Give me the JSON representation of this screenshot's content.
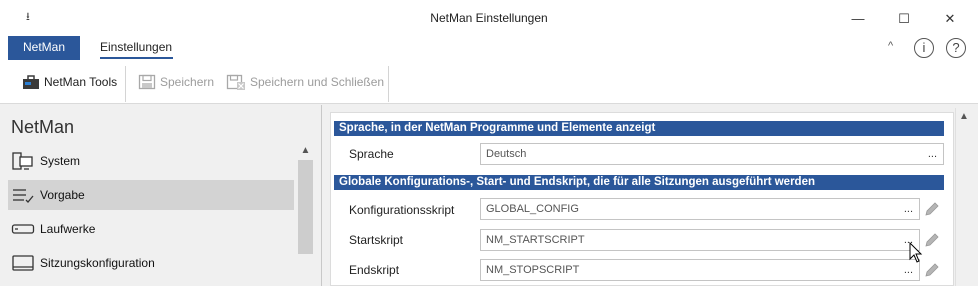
{
  "window": {
    "title": "NetMan Einstellungen",
    "qat_glyph": "⭳",
    "minimize": "—",
    "maximize": "☐",
    "close": "✕"
  },
  "tabs": {
    "file": "NetMan",
    "settings": "Einstellungen"
  },
  "ribbon": {
    "collapse": "^",
    "info": "i",
    "help": "?",
    "tools": "NetMan Tools",
    "save": "Speichern",
    "save_close": "Speichern und Schließen"
  },
  "nav": {
    "title": "NetMan",
    "items": [
      {
        "label": "System",
        "icon": "system-icon"
      },
      {
        "label": "Vorgabe",
        "icon": "list-check-icon",
        "selected": true
      },
      {
        "label": "Laufwerke",
        "icon": "drive-icon"
      },
      {
        "label": "Sitzungskonfiguration",
        "icon": "session-icon"
      }
    ]
  },
  "content": {
    "section1": "Sprache, in der NetMan Programme und Elemente anzeigt",
    "language": {
      "label": "Sprache",
      "value": "Deutsch"
    },
    "section2": "Globale Konfigurations-, Start- und Endskript, die für alle Sitzungen ausgeführt werden",
    "config": {
      "label": "Konfigurationsskript",
      "value": "GLOBAL_CONFIG"
    },
    "start": {
      "label": "Startskript",
      "value": "NM_STARTSCRIPT"
    },
    "end": {
      "label": "Endskript",
      "value": "NM_STOPSCRIPT"
    },
    "browse": "..."
  },
  "colors": {
    "accent": "#2b579a",
    "selected": "#d3d3d3"
  }
}
